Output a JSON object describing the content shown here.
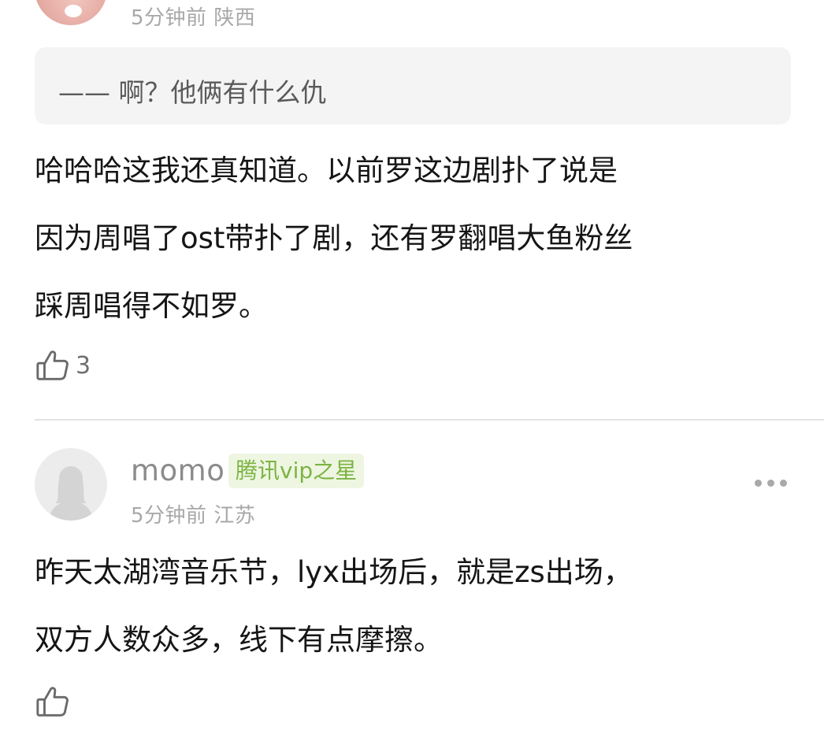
{
  "comments": [
    {
      "time": "5分钟前",
      "location": "陕西",
      "quote": "—— 啊？他俩有什么仇",
      "lines": [
        "哈哈哈这我还真知道。以前罗这边剧扑了说是",
        "因为周唱了ost带扑了剧，还有罗翻唱大鱼粉丝",
        "踩周唱得不如罗。"
      ],
      "likes": "3"
    },
    {
      "username": "momo",
      "badge": "腾讯vip之星",
      "time": "5分钟前",
      "location": "江苏",
      "lines": [
        "昨天太湖湾音乐节，lyx出场后，就是zs出场，",
        "双方人数众多，线下有点摩擦。"
      ],
      "likes": ""
    }
  ],
  "icons": {
    "like": "thumbs-up-icon",
    "more": "more-horizontal-icon"
  },
  "colors": {
    "meta": "#a8a8a8",
    "badge_text": "#7cb342",
    "badge_bg": "#eef6e2",
    "quote_bg": "#f4f4f4",
    "divider": "#e3e3e3"
  }
}
